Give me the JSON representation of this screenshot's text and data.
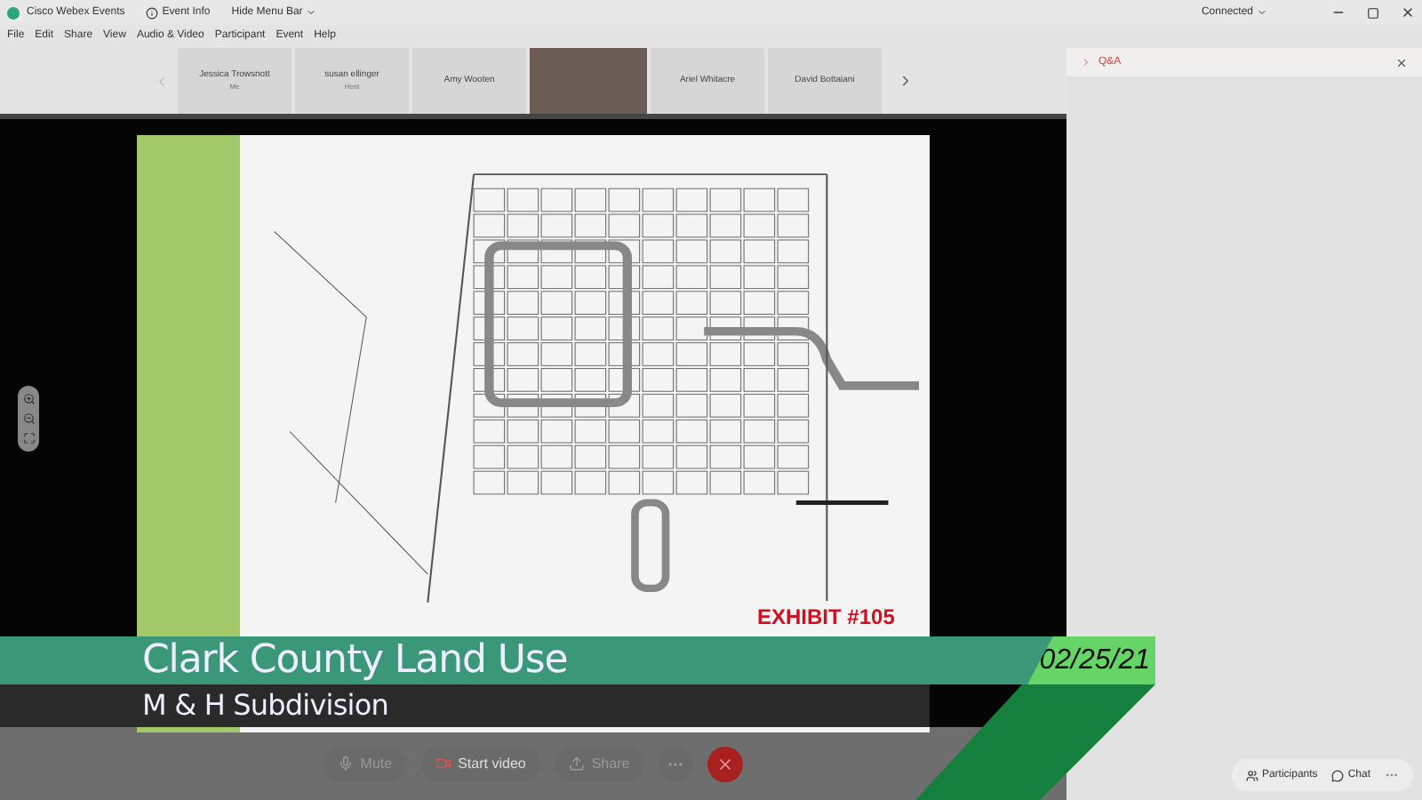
{
  "window": {
    "app_name": "Cisco Webex Events",
    "event_info": "Event Info",
    "hide_menu": "Hide Menu Bar",
    "status": "Connected"
  },
  "menu": [
    "File",
    "Edit",
    "Share",
    "View",
    "Audio & Video",
    "Participant",
    "Event",
    "Help"
  ],
  "participants": [
    {
      "kind": "name",
      "name": "Jessica Trowsnott",
      "role": "Me"
    },
    {
      "kind": "name",
      "name": "susan ellinger",
      "role": "Host"
    },
    {
      "kind": "name",
      "name": "Amy Wooten"
    },
    {
      "kind": "video"
    },
    {
      "kind": "name",
      "name": "Ariel Whitacre"
    },
    {
      "kind": "name",
      "name": "David Bottaiani"
    }
  ],
  "panel": {
    "title": "Q&A"
  },
  "slide": {
    "exhibit": "EXHIBIT #105"
  },
  "lower_third": {
    "title": "Clark County Land Use",
    "subtitle": "M & H Subdivision",
    "date": "02/25/21"
  },
  "controls": [
    {
      "kind": "mute",
      "label": "Mute"
    },
    {
      "kind": "video",
      "label": "Start video"
    },
    {
      "kind": "share",
      "label": "Share"
    },
    {
      "kind": "more"
    },
    {
      "kind": "leave"
    }
  ],
  "bottom_right": [
    {
      "kind": "participants",
      "label": "Participants"
    },
    {
      "kind": "chat",
      "label": "Chat"
    }
  ]
}
